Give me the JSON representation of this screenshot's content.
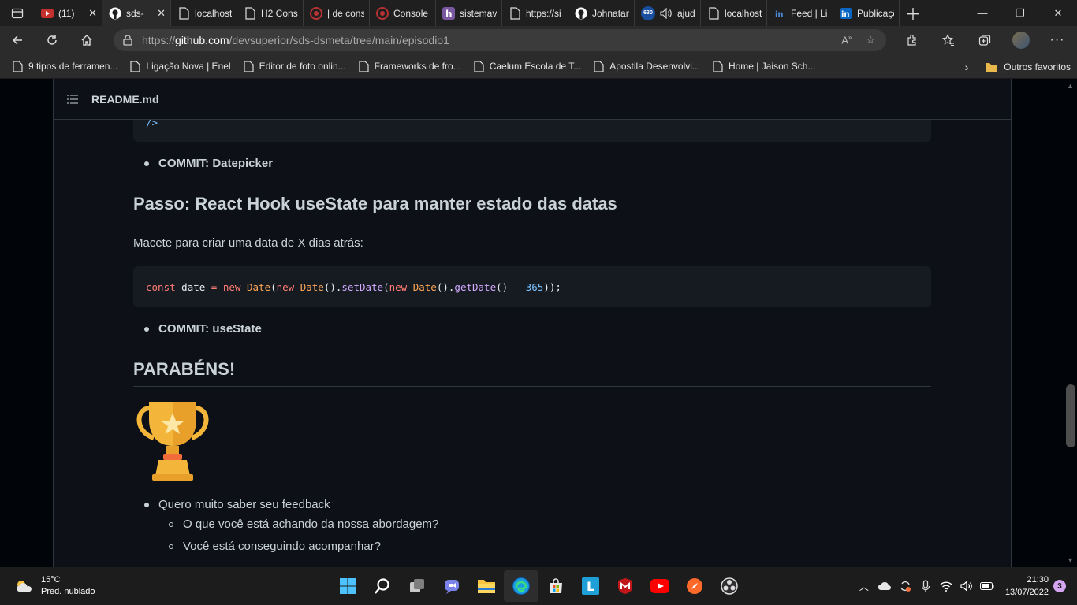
{
  "browser": {
    "tabs": [
      {
        "title": "(11)",
        "icon": "youtube-icon"
      },
      {
        "title": "sds-",
        "icon": "github-icon",
        "active": true
      },
      {
        "title": "localhost",
        "icon": "page-icon"
      },
      {
        "title": "H2 Cons",
        "icon": "page-icon"
      },
      {
        "title": "| de cons",
        "icon": "h2-icon"
      },
      {
        "title": "Console",
        "icon": "h2-icon"
      },
      {
        "title": "sistemav",
        "icon": "heroku-icon"
      },
      {
        "title": "https://si",
        "icon": "page-icon"
      },
      {
        "title": "Johnatan",
        "icon": "github-icon"
      },
      {
        "title": "ajud",
        "icon": "audio-icon"
      },
      {
        "title": "localhost",
        "icon": "page-icon"
      },
      {
        "title": "Feed | Lir",
        "icon": "linkedin-icon"
      },
      {
        "title": "Publicaçõ",
        "icon": "linkedin-icon"
      }
    ],
    "tab_badge": "630",
    "url": {
      "prefix": "https://",
      "host": "github.com",
      "path": "/devsuperior/sds-dsmeta/tree/main/episodio1"
    },
    "bookmarks": [
      "9 tipos de ferramen...",
      "Ligação Nova | Enel",
      "Editor de foto onlin...",
      "Frameworks de fro...",
      "Caelum Escola de T...",
      "Apostila Desenvolvi...",
      "Home | Jaison Sch..."
    ],
    "other_favorites": "Outros favoritos"
  },
  "readme": {
    "filename": "README.md",
    "code_top_tail": "/>",
    "commit_datepicker": "COMMIT: Datepicker",
    "step_heading": "Passo: React Hook useState para manter estado das datas",
    "tip_text": "Macete para criar uma data de X dias atrás:",
    "code": {
      "t1": "const",
      "t2": " date ",
      "t3": "=",
      "t4": " new ",
      "t5": "Date",
      "t6": "(",
      "t7": "new ",
      "t8": "Date",
      "t9": "().",
      "t10": "setDate",
      "t11": "(",
      "t12": "new ",
      "t13": "Date",
      "t14": "().",
      "t15": "getDate",
      "t16": "() ",
      "t17": "-",
      "t18": " 365",
      "t19": "));"
    },
    "commit_usestate": "COMMIT: useState",
    "congrats_heading": "PARABÉNS!",
    "feedback": "Quero muito saber seu feedback",
    "feedback_items": [
      "O que você está achando da nossa abordagem?",
      "Você está conseguindo acompanhar?"
    ]
  },
  "taskbar": {
    "temperature": "15°C",
    "weather": "Pred. nublado",
    "time": "21:30",
    "date": "13/07/2022",
    "notifications": "3"
  },
  "colors": {
    "page_bg": "#0d1117",
    "accent_keyword": "#ff7b72",
    "accent_function": "#d2a8ff",
    "accent_number": "#79c0ff"
  }
}
